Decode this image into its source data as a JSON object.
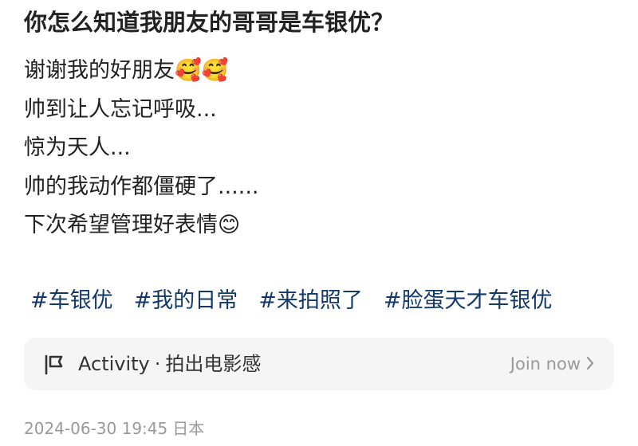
{
  "post": {
    "title": "你怎么知道我朋友的哥哥是车银优？",
    "lines": [
      "谢谢我的好朋友🥰🥰",
      "帅到让人忘记呼吸...",
      "惊为天人...",
      "帅的我动作都僵硬了......",
      "下次希望管理好表情😊"
    ],
    "tags": [
      "#车银优",
      "#我的日常",
      "#来拍照了",
      "#脸蛋天才车银优"
    ]
  },
  "activity": {
    "icon": "activity-flag-icon",
    "label": "Activity",
    "separator": "·",
    "name": "拍出电影感",
    "join_label": "Join now"
  },
  "meta": {
    "timestamp": "2024-06-30 19:45",
    "location": "日本"
  },
  "colors": {
    "tag": "#13386c",
    "card_bg": "#f5f5f5",
    "muted": "#999999"
  }
}
